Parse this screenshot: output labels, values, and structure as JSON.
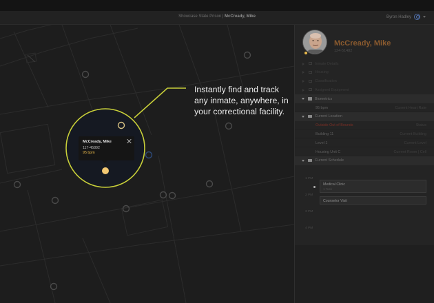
{
  "window": {
    "title_prefix": "Showcase State Prison | ",
    "title_name": "McCready, Mike",
    "user_name": "Byron Hadley"
  },
  "map": {
    "popup": {
      "name": "McCready, Mike",
      "id": "117-45892",
      "bpm": "95 bpm"
    },
    "accent_color": "#c8cf39",
    "marker_color": "#f3c872",
    "tagline": "Instantly find and track any inmate, anywhere, in your correctional facility."
  },
  "panel": {
    "name": "McCready, Mike",
    "id": "124-51482",
    "collapsed_sections": [
      {
        "label": "Inmate Details"
      },
      {
        "label": "Housing"
      },
      {
        "label": "Classification"
      },
      {
        "label": "Assigned Equipment"
      }
    ],
    "biometrics": {
      "label": "Biometrics",
      "rows": [
        {
          "left": "95 bpm",
          "right": "Current Heart Rate"
        }
      ]
    },
    "location": {
      "label": "Current Location",
      "rows": [
        {
          "left": "Outside Out of Bounds",
          "right": "Status",
          "alert": true
        },
        {
          "left": "Building 11",
          "right": "Current Building"
        },
        {
          "left": "Level 1",
          "right": "Current Level"
        },
        {
          "left": "Housing Unit C",
          "right": "Current Room | Cell"
        }
      ]
    },
    "schedule": {
      "label": "Current Schedule",
      "hours": [
        "1 PM",
        "2 PM",
        "3 PM",
        "4 PM"
      ],
      "events": [
        {
          "name": "Medical Clinic",
          "sub": "1 Task"
        },
        {
          "name": "Counselor Visit",
          "sub": ""
        }
      ]
    }
  }
}
